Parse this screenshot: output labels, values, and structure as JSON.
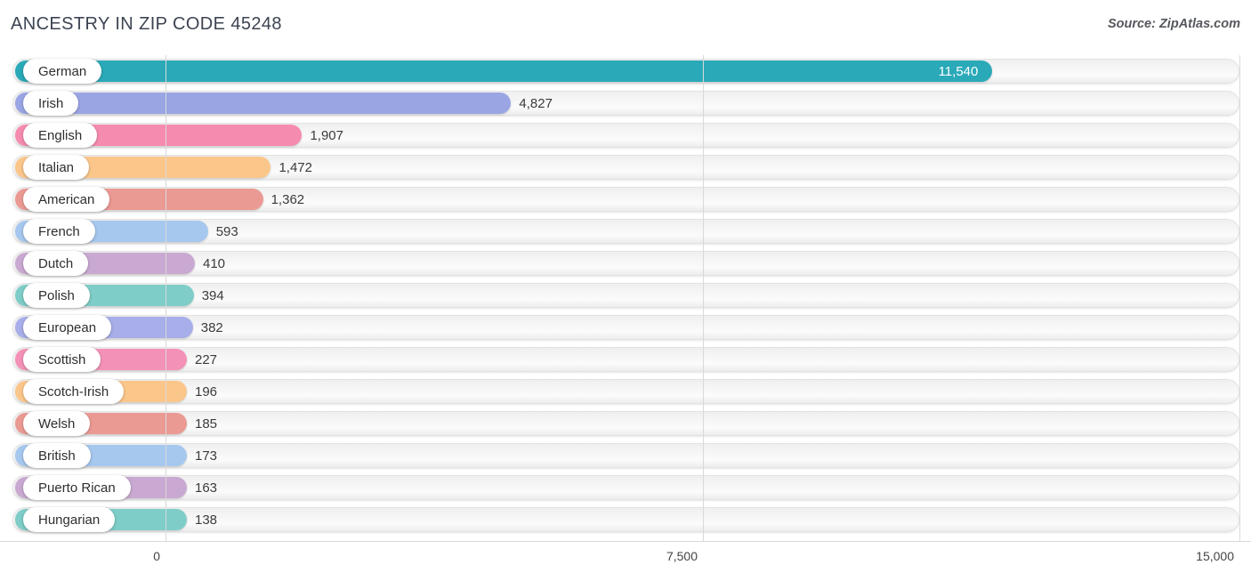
{
  "header": {
    "title": "ANCESTRY IN ZIP CODE 45248",
    "source": "Source: ZipAtlas.com"
  },
  "axis": {
    "ticks": [
      "0",
      "7,500",
      "15,000"
    ],
    "min": 0,
    "max": 15000
  },
  "chart_data": {
    "type": "bar",
    "orientation": "horizontal",
    "title": "ANCESTRY IN ZIP CODE 45248",
    "xlabel": "",
    "ylabel": "",
    "xlim": [
      0,
      15000
    ],
    "grid": true,
    "legend": "none",
    "xticks": [
      0,
      7500,
      15000
    ],
    "xtick_labels": [
      "0",
      "7,500",
      "15,000"
    ],
    "categories": [
      "German",
      "Irish",
      "English",
      "Italian",
      "American",
      "French",
      "Dutch",
      "Polish",
      "European",
      "Scottish",
      "Scotch-Irish",
      "Welsh",
      "British",
      "Puerto Rican",
      "Hungarian"
    ],
    "values": [
      11540,
      4827,
      1907,
      1472,
      1362,
      593,
      410,
      394,
      382,
      227,
      196,
      185,
      173,
      163,
      138
    ],
    "value_labels": [
      "11,540",
      "4,827",
      "1,907",
      "1,472",
      "1,362",
      "593",
      "410",
      "394",
      "382",
      "227",
      "196",
      "185",
      "173",
      "163",
      "138"
    ],
    "colors": [
      "#2aa9b8",
      "#9aa5e4",
      "#f68bb0",
      "#fbc68a",
      "#eb9a93",
      "#a6c8ee",
      "#c9a9d1",
      "#7ecdc8",
      "#a7aee9",
      "#f491b7",
      "#fbc68a",
      "#eb9a93",
      "#a6c8ee",
      "#c9a9d1",
      "#7ecdc8"
    ]
  },
  "rows": [
    {
      "label": "German",
      "value_label": "11,540",
      "value": 11540,
      "color": "#2aa9b8",
      "label_inside": true
    },
    {
      "label": "Irish",
      "value_label": "4,827",
      "value": 4827,
      "color": "#9aa5e4",
      "label_inside": false
    },
    {
      "label": "English",
      "value_label": "1,907",
      "value": 1907,
      "color": "#f68bb0",
      "label_inside": false
    },
    {
      "label": "Italian",
      "value_label": "1,472",
      "value": 1472,
      "color": "#fbc68a",
      "label_inside": false
    },
    {
      "label": "American",
      "value_label": "1,362",
      "value": 1362,
      "color": "#eb9a93",
      "label_inside": false
    },
    {
      "label": "French",
      "value_label": "593",
      "value": 593,
      "color": "#a6c8ee",
      "label_inside": false
    },
    {
      "label": "Dutch",
      "value_label": "410",
      "value": 410,
      "color": "#c9a9d1",
      "label_inside": false
    },
    {
      "label": "Polish",
      "value_label": "394",
      "value": 394,
      "color": "#7ecdc8",
      "label_inside": false
    },
    {
      "label": "European",
      "value_label": "382",
      "value": 382,
      "color": "#a7aee9",
      "label_inside": false
    },
    {
      "label": "Scottish",
      "value_label": "227",
      "value": 227,
      "color": "#f491b7",
      "label_inside": false
    },
    {
      "label": "Scotch-Irish",
      "value_label": "196",
      "value": 196,
      "color": "#fbc68a",
      "label_inside": false
    },
    {
      "label": "Welsh",
      "value_label": "185",
      "value": 185,
      "color": "#eb9a93",
      "label_inside": false
    },
    {
      "label": "British",
      "value_label": "173",
      "value": 173,
      "color": "#a6c8ee",
      "label_inside": false
    },
    {
      "label": "Puerto Rican",
      "value_label": "163",
      "value": 163,
      "color": "#c9a9d1",
      "label_inside": false
    },
    {
      "label": "Hungarian",
      "value_label": "138",
      "value": 138,
      "color": "#7ecdc8",
      "label_inside": false
    }
  ]
}
